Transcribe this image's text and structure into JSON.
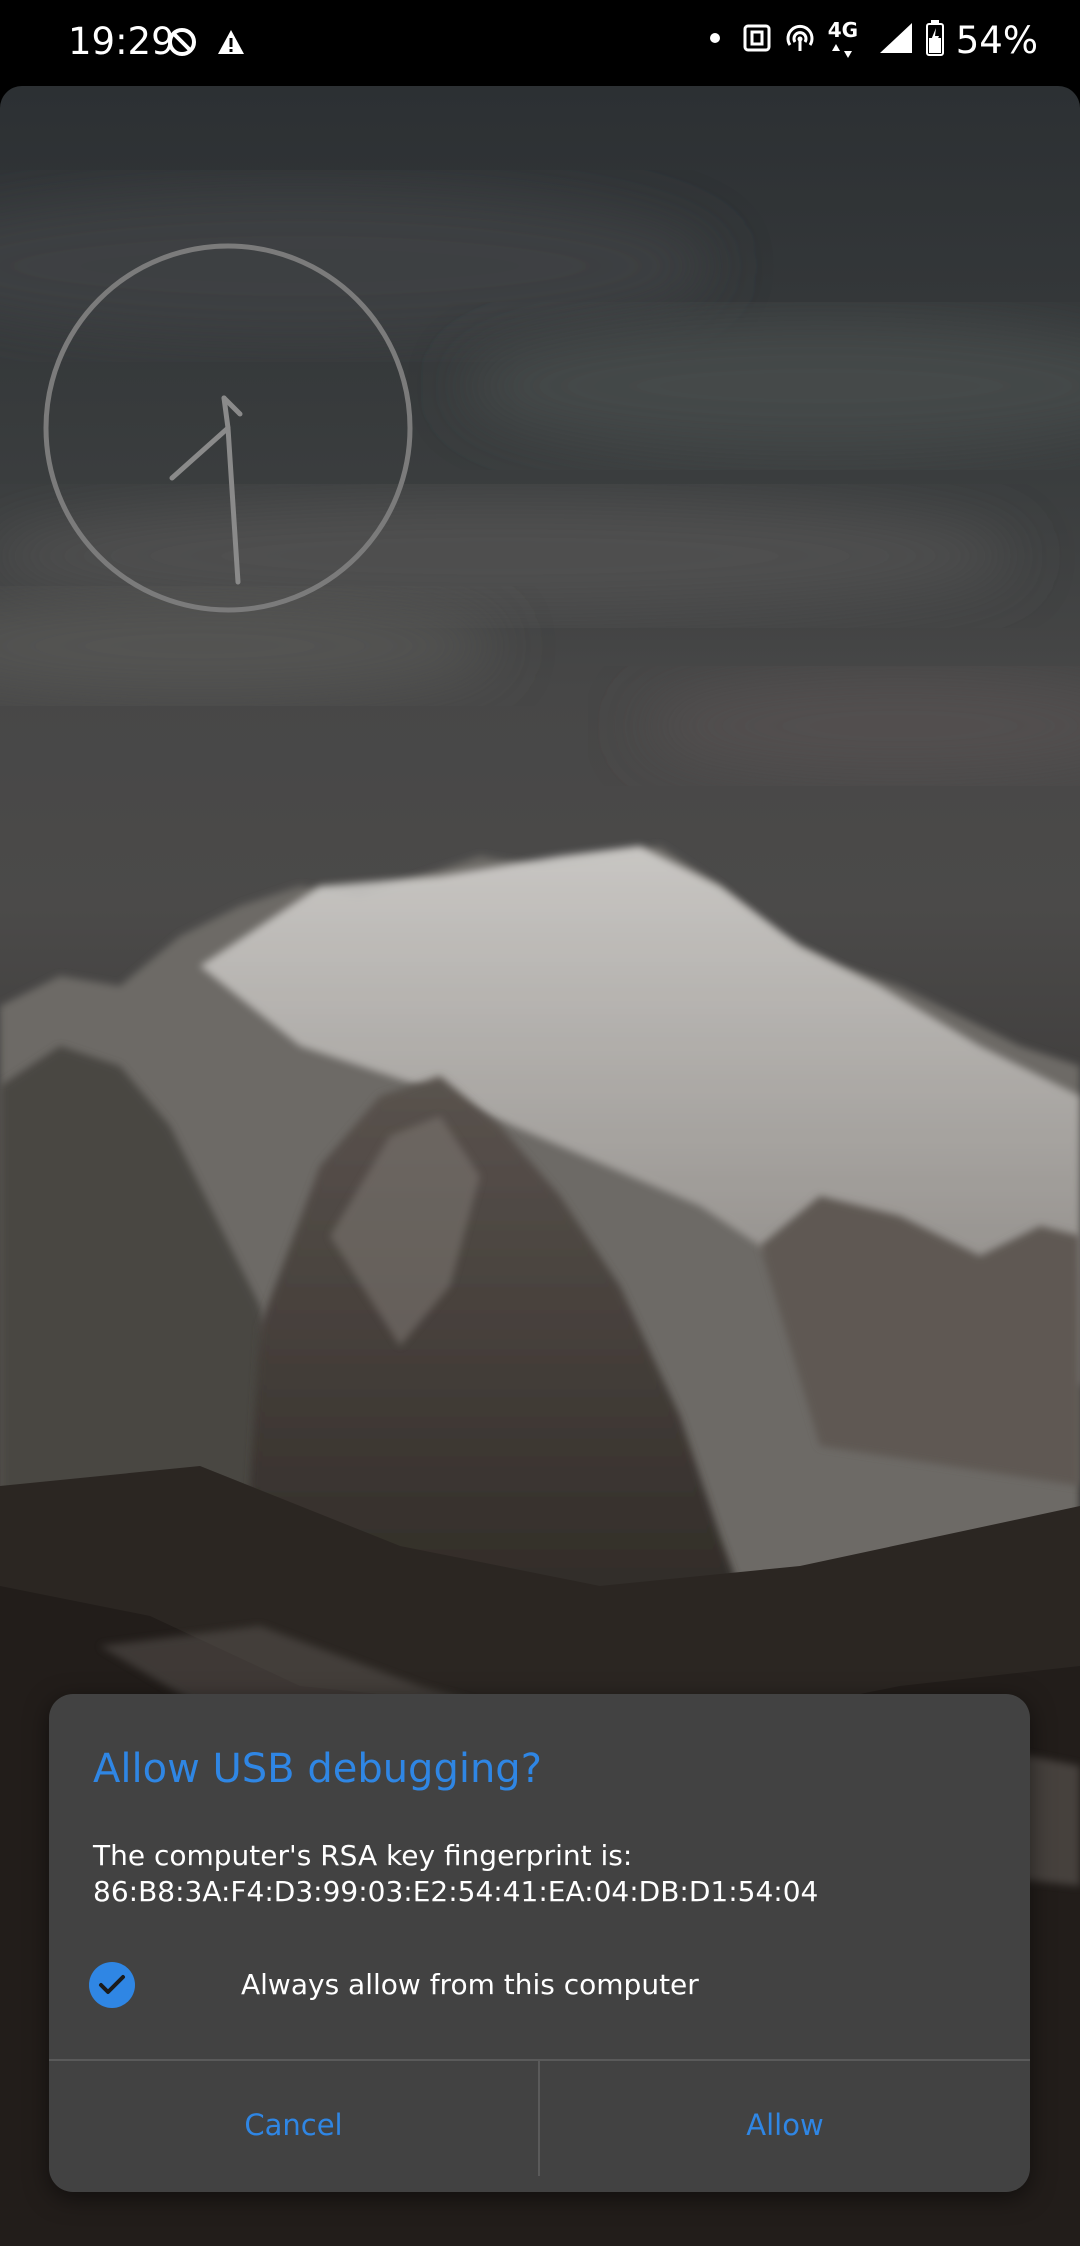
{
  "status_bar": {
    "time": "19:29",
    "battery": "54%",
    "network": "4G"
  },
  "dialog": {
    "title": "Allow USB debugging?",
    "message_line1": "The computer's RSA key fingerprint is:",
    "message_line2": "86:B8:3A:F4:D3:99:03:E2:54:41:EA:04:DB:D1:54:04",
    "checkbox_label": "Always allow from this computer",
    "checkbox_checked": true,
    "cancel_label": "Cancel",
    "allow_label": "Allow"
  },
  "colors": {
    "accent": "#2f86e4",
    "dialog_bg": "#424242",
    "status_bar_bg": "#000000"
  },
  "icons": [
    "data-saver-icon",
    "warning-icon",
    "notification-dot-icon",
    "nfc-icon",
    "hotspot-icon",
    "signal-icon",
    "battery-icon",
    "checkmark-icon"
  ]
}
